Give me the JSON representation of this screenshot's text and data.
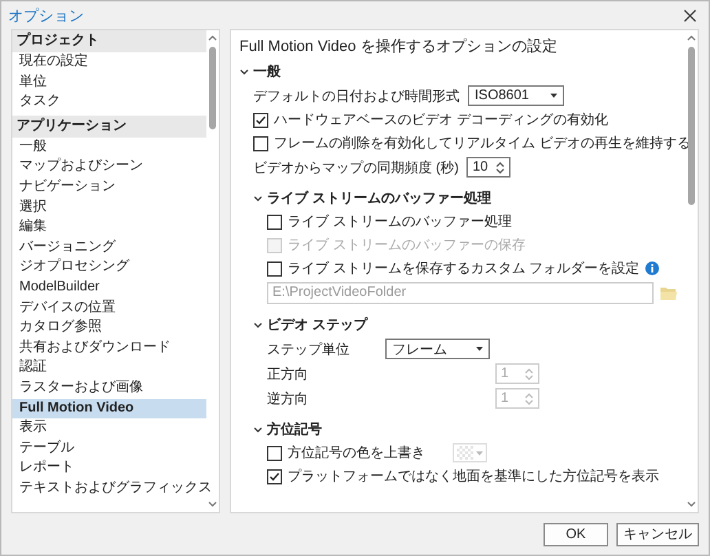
{
  "window": {
    "title": "オプション"
  },
  "sidebar": {
    "groups": [
      {
        "label": "プロジェクト",
        "items": [
          {
            "label": "現在の設定",
            "selected": false
          },
          {
            "label": "単位",
            "selected": false
          },
          {
            "label": "タスク",
            "selected": false
          }
        ]
      },
      {
        "label": "アプリケーション",
        "items": [
          {
            "label": "一般",
            "selected": false
          },
          {
            "label": "マップおよびシーン",
            "selected": false
          },
          {
            "label": "ナビゲーション",
            "selected": false
          },
          {
            "label": "選択",
            "selected": false
          },
          {
            "label": "編集",
            "selected": false
          },
          {
            "label": "バージョニング",
            "selected": false
          },
          {
            "label": "ジオプロセシング",
            "selected": false
          },
          {
            "label": "ModelBuilder",
            "selected": false
          },
          {
            "label": "デバイスの位置",
            "selected": false
          },
          {
            "label": "カタログ参照",
            "selected": false
          },
          {
            "label": "共有およびダウンロード",
            "selected": false
          },
          {
            "label": "認証",
            "selected": false
          },
          {
            "label": "ラスターおよび画像",
            "selected": false
          },
          {
            "label": "Full Motion Video",
            "selected": true
          },
          {
            "label": "表示",
            "selected": false
          },
          {
            "label": "テーブル",
            "selected": false
          },
          {
            "label": "レポート",
            "selected": false
          },
          {
            "label": "テキストおよびグラフィックス",
            "selected": false
          }
        ]
      }
    ]
  },
  "content": {
    "heading": "Full Motion Video を操作するオプションの設定",
    "sections": [
      {
        "title": "一般",
        "expanded": true,
        "rows": [
          {
            "kind": "dropdown",
            "label": "デフォルトの日付および時間形式",
            "value": "ISO8601"
          },
          {
            "kind": "checkbox",
            "label": "ハードウェアベースのビデオ デコーディングの有効化",
            "checked": true,
            "disabled": false
          },
          {
            "kind": "checkbox",
            "label": "フレームの削除を有効化してリアルタイム ビデオの再生を維持する",
            "checked": false,
            "disabled": false
          },
          {
            "kind": "spinner",
            "label": "ビデオからマップの同期頻度 (秒)",
            "value": "10",
            "disabled": false
          }
        ],
        "children": [
          {
            "title": "ライブ ストリームのバッファー処理",
            "expanded": true,
            "rows": [
              {
                "kind": "checkbox",
                "label": "ライブ ストリームのバッファー処理",
                "checked": false,
                "disabled": false
              },
              {
                "kind": "checkbox",
                "label": "ライブ ストリームのバッファーの保存",
                "checked": false,
                "disabled": true
              },
              {
                "kind": "checkbox_info",
                "label": "ライブ ストリームを保存するカスタム フォルダーを設定",
                "checked": false,
                "disabled": false
              },
              {
                "kind": "path",
                "value": "E:\\ProjectVideoFolder"
              }
            ]
          },
          {
            "title": "ビデオ ステップ",
            "expanded": true,
            "rows": [
              {
                "kind": "dropdown",
                "label": "ステップ単位",
                "value": "フレーム"
              },
              {
                "kind": "spinner",
                "label": "正方向",
                "value": "1",
                "disabled": true
              },
              {
                "kind": "spinner",
                "label": "逆方向",
                "value": "1",
                "disabled": true
              }
            ]
          },
          {
            "title": "方位記号",
            "expanded": true,
            "rows": [
              {
                "kind": "checkbox_color",
                "label": "方位記号の色を上書き",
                "checked": false,
                "disabled": false
              },
              {
                "kind": "checkbox",
                "label": "プラットフォームではなく地面を基準にした方位記号を表示",
                "checked": true,
                "disabled": false
              }
            ]
          }
        ]
      }
    ]
  },
  "buttons": [
    {
      "label": "OK"
    },
    {
      "label": "キャンセル"
    }
  ]
}
